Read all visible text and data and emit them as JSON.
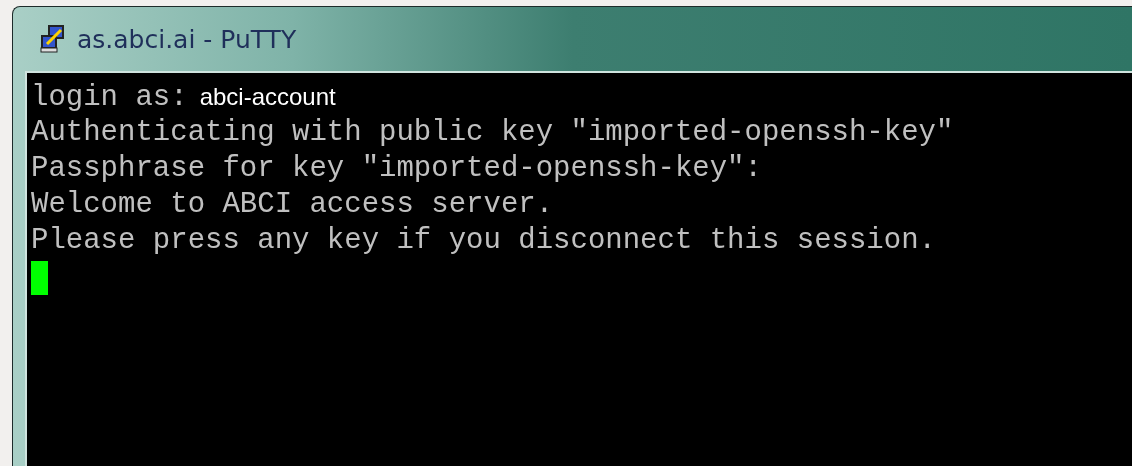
{
  "window": {
    "title": "as.abci.ai - PuTTY"
  },
  "terminal": {
    "lines": [
      {
        "text": "login as:",
        "input": "abci-account"
      },
      {
        "text": "Authenticating with public key \"imported-openssh-key\""
      },
      {
        "text": "Passphrase for key \"imported-openssh-key\":"
      },
      {
        "text": "Welcome to ABCI access server."
      },
      {
        "text": "Please press any key if you disconnect this session."
      }
    ],
    "cursor": true
  }
}
